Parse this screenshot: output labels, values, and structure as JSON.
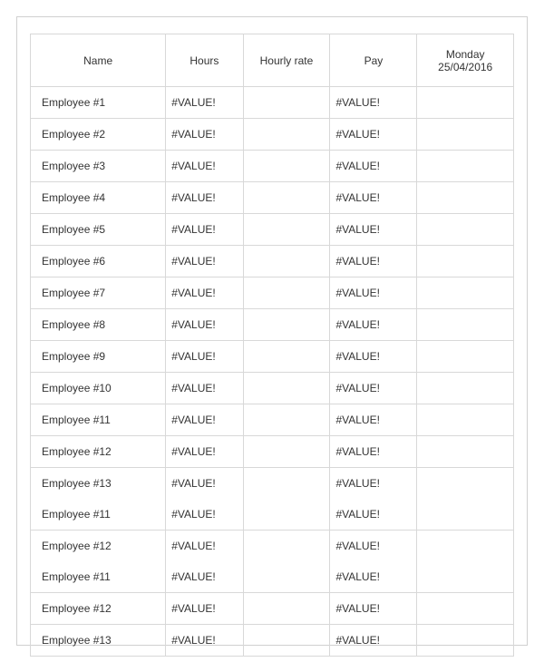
{
  "headers": {
    "name": "Name",
    "hours": "Hours",
    "rate": "Hourly rate",
    "pay": "Pay",
    "date_line1": "Monday",
    "date_line2": "25/04/2016"
  },
  "rows": [
    {
      "name": "Employee #1",
      "hours": "#VALUE!",
      "rate": "",
      "pay": "#VALUE!",
      "date": "",
      "merge": ""
    },
    {
      "name": "Employee #2",
      "hours": "#VALUE!",
      "rate": "",
      "pay": "#VALUE!",
      "date": "",
      "merge": ""
    },
    {
      "name": "Employee #3",
      "hours": "#VALUE!",
      "rate": "",
      "pay": "#VALUE!",
      "date": "",
      "merge": ""
    },
    {
      "name": "Employee #4",
      "hours": "#VALUE!",
      "rate": "",
      "pay": "#VALUE!",
      "date": "",
      "merge": ""
    },
    {
      "name": "Employee #5",
      "hours": "#VALUE!",
      "rate": "",
      "pay": "#VALUE!",
      "date": "",
      "merge": ""
    },
    {
      "name": "Employee #6",
      "hours": "#VALUE!",
      "rate": "",
      "pay": "#VALUE!",
      "date": "",
      "merge": ""
    },
    {
      "name": "Employee #7",
      "hours": "#VALUE!",
      "rate": "",
      "pay": "#VALUE!",
      "date": "",
      "merge": ""
    },
    {
      "name": "Employee #8",
      "hours": "#VALUE!",
      "rate": "",
      "pay": "#VALUE!",
      "date": "",
      "merge": ""
    },
    {
      "name": "Employee #9",
      "hours": "#VALUE!",
      "rate": "",
      "pay": "#VALUE!",
      "date": "",
      "merge": ""
    },
    {
      "name": "Employee #10",
      "hours": "#VALUE!",
      "rate": "",
      "pay": "#VALUE!",
      "date": "",
      "merge": ""
    },
    {
      "name": "Employee #11",
      "hours": "#VALUE!",
      "rate": "",
      "pay": "#VALUE!",
      "date": "",
      "merge": ""
    },
    {
      "name": "Employee #12",
      "hours": "#VALUE!",
      "rate": "",
      "pay": "#VALUE!",
      "date": "",
      "merge": ""
    },
    {
      "name": "Employee #13",
      "hours": "#VALUE!",
      "rate": "",
      "pay": "#VALUE!",
      "date": "",
      "merge": "nb-bottom"
    },
    {
      "name": "Employee #11",
      "hours": "#VALUE!",
      "rate": "",
      "pay": "#VALUE!",
      "date": "",
      "merge": "nb-top"
    },
    {
      "name": "Employee #12",
      "hours": "#VALUE!",
      "rate": "",
      "pay": "#VALUE!",
      "date": "",
      "merge": "nb-bottom"
    },
    {
      "name": "Employee #11",
      "hours": "#VALUE!",
      "rate": "",
      "pay": "#VALUE!",
      "date": "",
      "merge": "nb-top"
    },
    {
      "name": "Employee #12",
      "hours": "#VALUE!",
      "rate": "",
      "pay": "#VALUE!",
      "date": "",
      "merge": ""
    },
    {
      "name": "Employee #13",
      "hours": "#VALUE!",
      "rate": "",
      "pay": "#VALUE!",
      "date": "",
      "merge": ""
    }
  ]
}
